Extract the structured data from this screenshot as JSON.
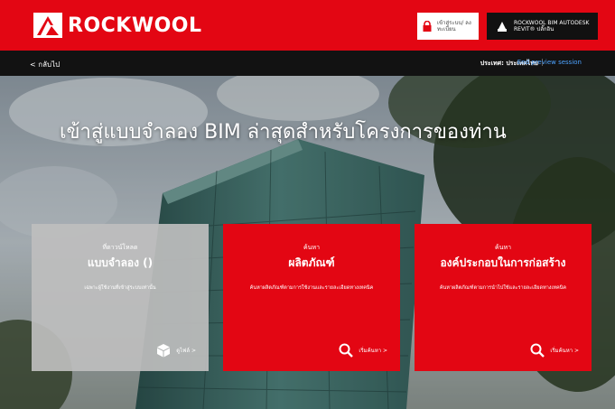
{
  "header": {
    "logo_text": "ROCKWOOL",
    "login_label": "เข้าสู่ระบบ/ ลงทะเบียน",
    "revit_label": "ROCKWOOL BIM AUTODESK REVIT® ปลั๊กอิน"
  },
  "subnav": {
    "back_label": "< กลับไป",
    "country_label": "ประเทศ: ประเทศไทย",
    "separator": "|",
    "end_preview_label": "End preview session"
  },
  "hero": {
    "title": "เข้าสู่แบบจำลอง BIM ล่าสุดสำหรับโครงการของท่าน"
  },
  "cards": [
    {
      "subtitle": "ที่ดาวน์โหลด",
      "title": "แบบจำลอง ()",
      "description": "เฉพาะผู้ใช้งานที่เข้าสู่ระบบเท่านั้น",
      "action_label": "ดูไฟล์ >",
      "action_icon": "box-icon"
    },
    {
      "subtitle": "ค้นหา",
      "title": "ผลิตภัณฑ์",
      "description": "ค้นหาผลิตภัณฑ์ตามการใช้งานและรายละเอียดทางเทคนิค",
      "action_label": "เริ่มค้นหา >",
      "action_icon": "search-icon"
    },
    {
      "subtitle": "ค้นหา",
      "title": "องค์ประกอบในการก่อสร้าง",
      "description": "ค้นหาผลิตภัณฑ์ตามการนำไปใช้และรายละเอียดทางเทคนิค",
      "action_label": "เริ่มค้นหา >",
      "action_icon": "search-icon"
    }
  ],
  "colors": {
    "brand_red": "#e30613",
    "dark_bar": "#121212",
    "link_blue": "#4da3ff"
  }
}
